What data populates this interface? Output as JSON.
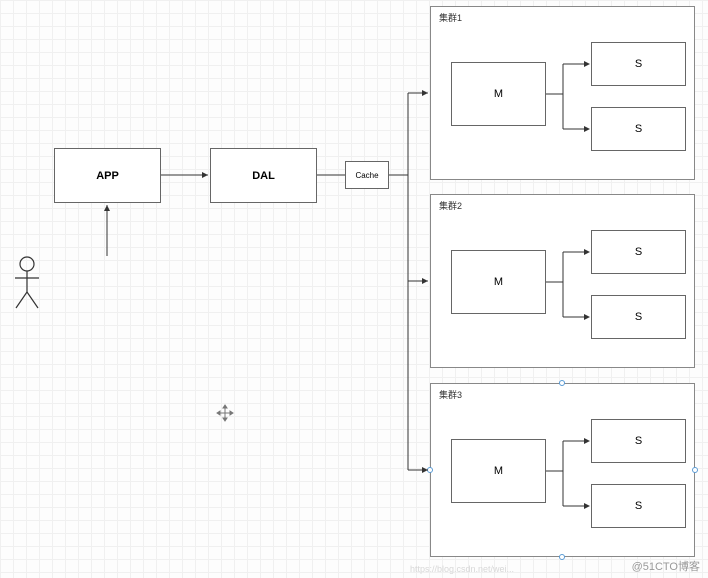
{
  "nodes": {
    "app": "APP",
    "dal": "DAL",
    "cache": "Cache",
    "m": "M",
    "s": "S"
  },
  "clusters": {
    "c1": "集群1",
    "c2": "集群2",
    "c3": "集群3"
  },
  "watermark": "@51CTO博客",
  "faint_watermark": "https://blog.csdn.net/wei..."
}
